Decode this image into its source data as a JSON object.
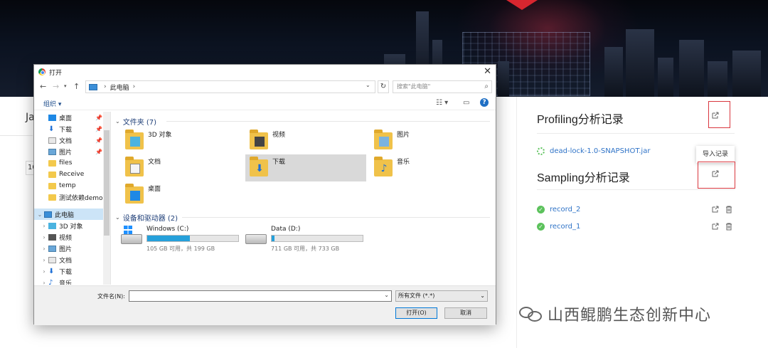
{
  "page": {
    "left_fragment_title": "Ja",
    "left_fragment_input": "10"
  },
  "profiling": {
    "title": "Profiling分析记录",
    "items": [
      {
        "name": "dead-lock-1.0-SNAPSHOT.jar",
        "status": "loading"
      }
    ]
  },
  "sampling": {
    "title": "Sampling分析记录",
    "items": [
      {
        "name": "record_2",
        "status": "ok"
      },
      {
        "name": "record_1",
        "status": "ok"
      }
    ]
  },
  "tooltip": "导入记录",
  "watermark": "山西鲲鹏生态创新中心",
  "dialog": {
    "title": "打开",
    "breadcrumb": [
      "此电脑"
    ],
    "search_placeholder": "搜索\"此电脑\"",
    "organize_label": "组织 ▾",
    "nav": [
      {
        "label": "桌面",
        "icon": "desktop-icon",
        "pinned": true
      },
      {
        "label": "下载",
        "icon": "download-icon",
        "pinned": true
      },
      {
        "label": "文档",
        "icon": "document-icon",
        "pinned": true
      },
      {
        "label": "图片",
        "icon": "picture-icon",
        "pinned": true
      },
      {
        "label": "files",
        "icon": "folder-icon",
        "pinned": false
      },
      {
        "label": "Receive",
        "icon": "folder-icon",
        "pinned": false
      },
      {
        "label": "temp",
        "icon": "folder-icon",
        "pinned": false
      },
      {
        "label": "测试依赖demo",
        "icon": "folder-icon",
        "pinned": false
      },
      {
        "label": "此电脑",
        "icon": "pc-icon",
        "selected": true
      },
      {
        "label": "3D 对象",
        "icon": "3d-objects-icon"
      },
      {
        "label": "视频",
        "icon": "video-icon"
      },
      {
        "label": "图片",
        "icon": "picture-icon"
      },
      {
        "label": "文档",
        "icon": "document-icon"
      },
      {
        "label": "下载",
        "icon": "download-icon"
      },
      {
        "label": "音乐",
        "icon": "music-icon"
      }
    ],
    "folders_header": "文件夹 (7)",
    "folders": [
      {
        "label": "3D 对象",
        "icon": "3d-objects-icon"
      },
      {
        "label": "视频",
        "icon": "video-icon"
      },
      {
        "label": "图片",
        "icon": "picture-icon"
      },
      {
        "label": "文档",
        "icon": "document-icon"
      },
      {
        "label": "下载",
        "icon": "download-icon",
        "selected": true
      },
      {
        "label": "音乐",
        "icon": "music-icon"
      },
      {
        "label": "桌面",
        "icon": "desktop-icon"
      }
    ],
    "devices_header": "设备和驱动器 (2)",
    "drives": [
      {
        "name": "Windows (C:)",
        "free": "105 GB 可用，共 199 GB",
        "used_fraction": 0.47
      },
      {
        "name": "Data (D:)",
        "free": "711 GB 可用，共 733 GB",
        "used_fraction": 0.03
      }
    ],
    "filename_label": "文件名(N):",
    "filename_value": "",
    "filter_value": "所有文件 (*.*)",
    "open_button": "打开(O)",
    "cancel_button": "取消"
  },
  "colors": {
    "accent": "#2f73c7",
    "highlight": "#d9363e",
    "ok": "#5cc25c"
  }
}
